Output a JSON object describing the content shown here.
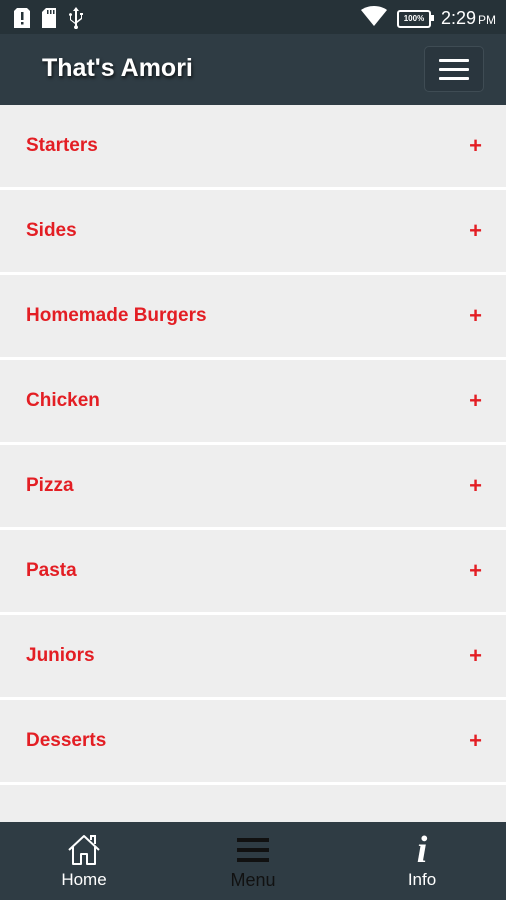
{
  "status_bar": {
    "time": "2:29",
    "ampm": "PM",
    "battery": "100%",
    "icons": [
      "alert-icon",
      "sd-card-icon",
      "usb-icon",
      "wifi-icon",
      "battery-icon"
    ]
  },
  "app_bar": {
    "title": "That's Amori",
    "menu_icon": "hamburger-menu-icon"
  },
  "categories": [
    {
      "label": "Starters",
      "toggle": "+"
    },
    {
      "label": "Sides",
      "toggle": "+"
    },
    {
      "label": "Homemade Burgers",
      "toggle": "+"
    },
    {
      "label": "Chicken",
      "toggle": "+"
    },
    {
      "label": "Pizza",
      "toggle": "+"
    },
    {
      "label": "Pasta",
      "toggle": "+"
    },
    {
      "label": "Juniors",
      "toggle": "+"
    },
    {
      "label": "Desserts",
      "toggle": "+"
    }
  ],
  "bottom_nav": {
    "home": {
      "label": "Home",
      "icon": "home-icon"
    },
    "menu": {
      "label": "Menu",
      "icon": "menu-icon",
      "active": true
    },
    "info": {
      "label": "Info",
      "icon": "info-icon",
      "glyph": "i"
    }
  },
  "colors": {
    "accent": "#e31e24",
    "bar_background": "#2f3c44",
    "row_background": "#eeeeee"
  }
}
